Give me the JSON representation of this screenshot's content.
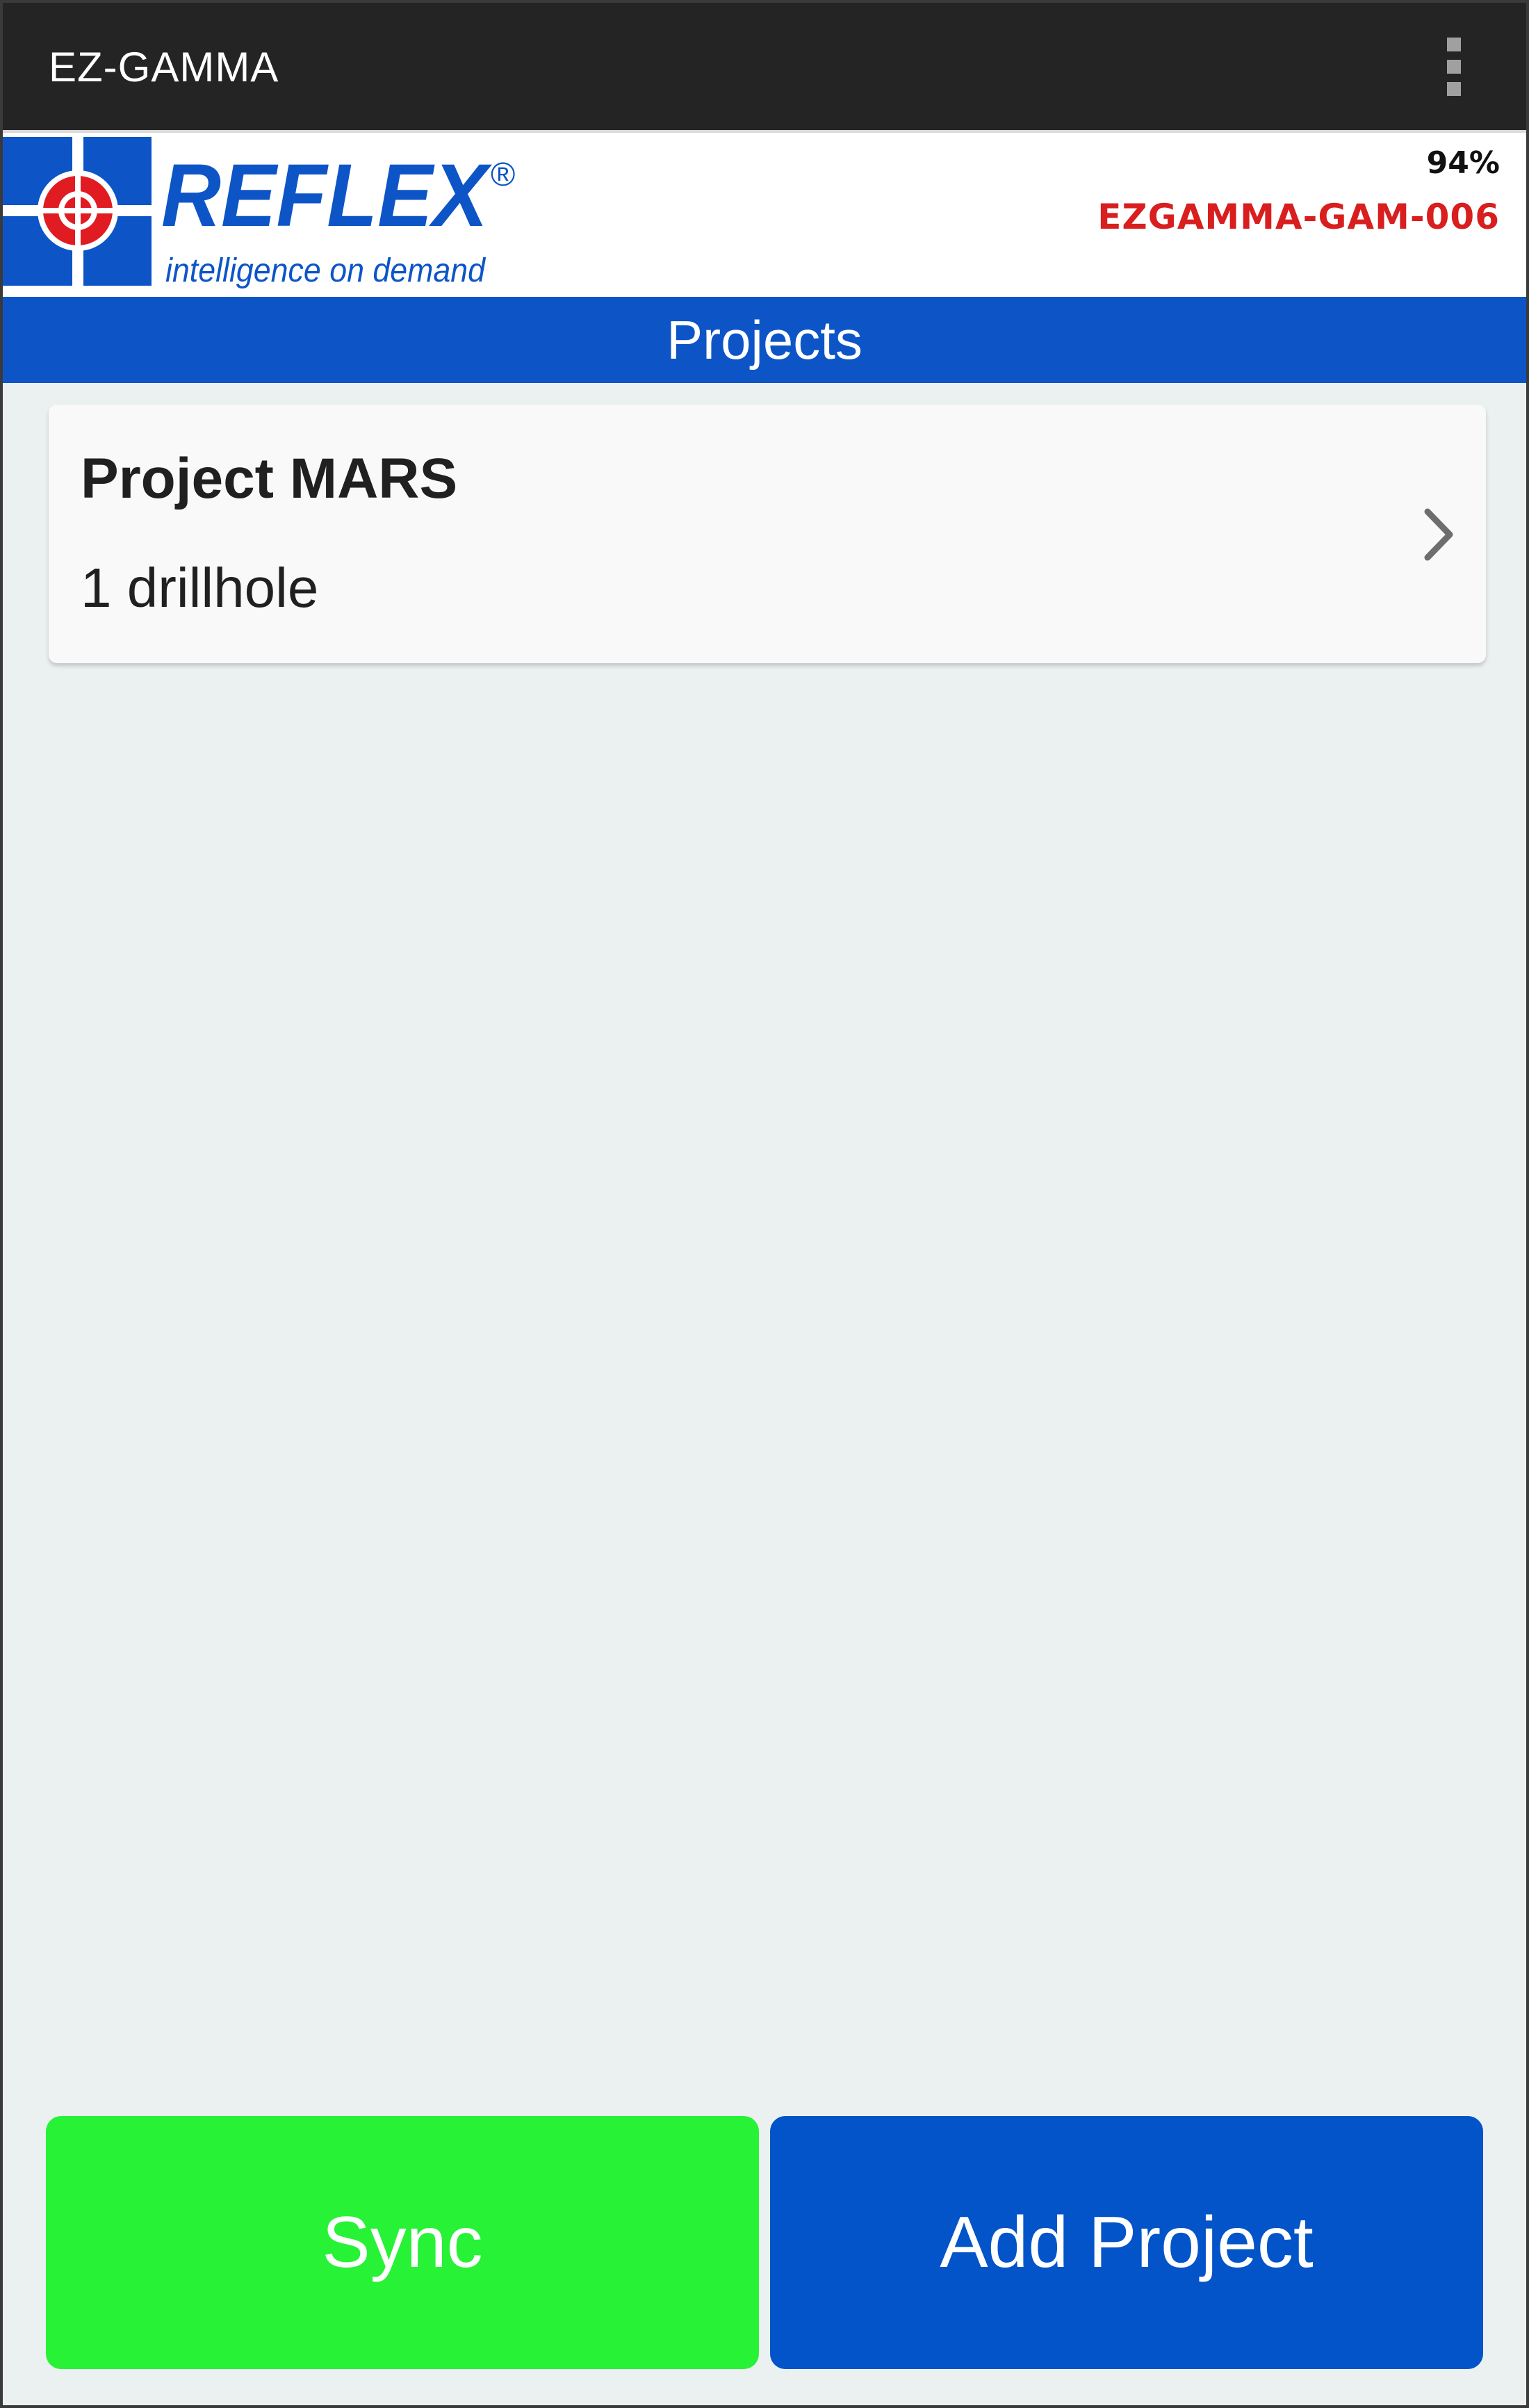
{
  "app_bar": {
    "title": "EZ-GAMMA",
    "menu_icon": "overflow-menu-icon"
  },
  "brand": {
    "logo_text": "REFLEX",
    "registered_mark": "®",
    "tagline": "intelligence on demand",
    "battery": "94%",
    "device_id": "EZGAMMA-GAM-006",
    "colors": {
      "logo_blue": "#0d55c7",
      "logo_red": "#e11b22",
      "device_id": "#d81e1e"
    }
  },
  "section": {
    "title": "Projects"
  },
  "projects": [
    {
      "name": "Project MARS",
      "subtitle": "1 drillhole",
      "icon": "chevron-right-icon"
    }
  ],
  "buttons": {
    "sync_label": "Sync",
    "add_project_label": "Add Project",
    "colors": {
      "sync": "#27f236",
      "add_project": "#0354c8"
    }
  }
}
